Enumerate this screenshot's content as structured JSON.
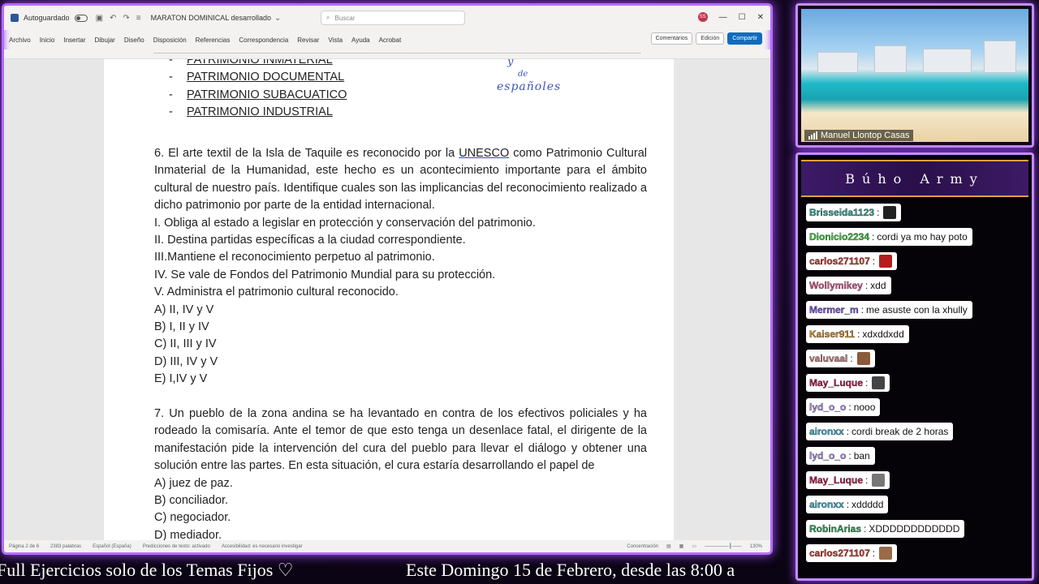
{
  "word": {
    "autosave_label": "Autoguardado",
    "doc_title": "MARATON DOMINICAL desarrollado",
    "search_placeholder": "Buscar",
    "avatar_initials": "SS",
    "tabs": [
      "Archivo",
      "Inicio",
      "Insertar",
      "Dibujar",
      "Diseño",
      "Disposición",
      "Referencias",
      "Correspondencia",
      "Revisar",
      "Vista",
      "Ayuda",
      "Acrobat"
    ],
    "comments_label": "Comentarios",
    "edit_label": "Edición",
    "share_label": "Compartir",
    "status": {
      "page": "Página 2 de 6",
      "words": "2383 palabras",
      "language": "Español (España)",
      "predictions": "Predicciones de texto: activado",
      "accessibility": "Accesibilidad: es necesario investigar",
      "focus": "Concentración",
      "zoom": "130%"
    }
  },
  "document": {
    "patrimonio_items": [
      "PATRIMONIO INMATERIAL",
      "PATRIMONIO DOCUMENTAL",
      "PATRIMONIO SUBACUATICO",
      "PATRIMONIO INDUSTRIAL"
    ],
    "handwritten": {
      "line1": "y",
      "line2": "de",
      "line3": "españoles"
    },
    "q6": {
      "before": "6. El arte textil de la Isla de Taquile es reconocido por la ",
      "unesco": "UNESCO",
      "after": " como Patrimonio Cultural Inmaterial de la Humanidad, este hecho es un acontecimiento importante para el ámbito cultural de nuestro país. Identifique cuales son las implicancias del reconocimiento realizado a dicho patrimonio por parte de la entidad internacional.",
      "statements": [
        "I.  Obliga al estado a legislar en protección y conservación del patrimonio.",
        "II. Destina partidas específicas a la ciudad correspondiente.",
        "III.Mantiene el reconocimiento perpetuo al patrimonio.",
        "IV.  Se vale de Fondos del Patrimonio Mundial para su protección.",
        "V. Administra el patrimonio cultural reconocido."
      ],
      "options": [
        "A) II, IV y V",
        "B) I, II y IV",
        "C) II, III y IV",
        "D) III, IV y V",
        "E) I,IV y V"
      ]
    },
    "q7": {
      "text": "7. Un pueblo de la zona andina se ha levantado en contra de los efectivos policiales y ha rodeado la comisaría. Ante el temor de que esto tenga un desenlace fatal, el dirigente de la manifestación pide la intervención del cura del pueblo para llevar el diálogo y obtener una solución entre las partes. En esta situación, el cura estaría desarrollando el papel de",
      "options": [
        "A) juez de paz.",
        "B) conciliador.",
        "C) negociador.",
        "D) mediador."
      ]
    }
  },
  "webcam": {
    "name": "Manuel Llontop Casas"
  },
  "chat": {
    "title": "Búho Army",
    "messages": [
      {
        "user": "Brisseida1123",
        "text": "",
        "color": "#2e9e8a",
        "emote": "#222222"
      },
      {
        "user": "Dionicio2234",
        "text": "cordi ya mo hay poto",
        "color": "#33c23a",
        "emote": ""
      },
      {
        "user": "carlos271107",
        "text": "",
        "color": "#c0392b",
        "emote": "#b71c1c"
      },
      {
        "user": "Wollymikey",
        "text": "xdd",
        "color": "#d05a8a",
        "emote": ""
      },
      {
        "user": "Mermer_m",
        "text": "me asuste con la xhully",
        "color": "#7a4fd0",
        "emote": ""
      },
      {
        "user": "Kaiser911",
        "text": "xdxddxdd",
        "color": "#d08a30",
        "emote": ""
      },
      {
        "user": "valuvaal",
        "text": "",
        "color": "#c07a7a",
        "emote": "#8a5a3a"
      },
      {
        "user": "May_Luque",
        "text": "",
        "color": "#b0204a",
        "emote": "#444444"
      },
      {
        "user": "lyd_o_o",
        "text": "nooo",
        "color": "#a88ad8",
        "emote": ""
      },
      {
        "user": "aironxx",
        "text": "cordi break de 2 horas",
        "color": "#3aa8c8",
        "emote": ""
      },
      {
        "user": "lyd_o_o",
        "text": "ban",
        "color": "#a88ad8",
        "emote": ""
      },
      {
        "user": "May_Luque",
        "text": "",
        "color": "#b0204a",
        "emote": "#777777"
      },
      {
        "user": "aironxx",
        "text": "xddddd",
        "color": "#3aa8c8",
        "emote": ""
      },
      {
        "user": "RobinArias",
        "text": "XDDDDDDDDDDDD",
        "color": "#2e9e5a",
        "emote": ""
      },
      {
        "user": "carlos271107",
        "text": "",
        "color": "#c0392b",
        "emote": "#9a6a4a"
      }
    ]
  },
  "ticker": {
    "left": "Full Ejercicios solo de los Temas Fijos ♡",
    "right": "Este Domingo 15 de Febrero, desde las 8:00 a"
  }
}
